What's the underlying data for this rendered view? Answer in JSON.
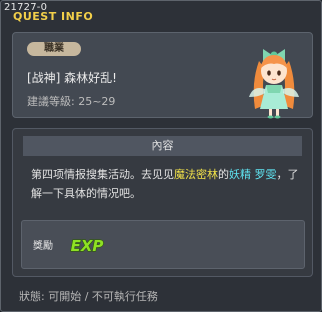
{
  "window": {
    "code": "21727-0",
    "title": "QUEST INFO"
  },
  "info": {
    "job_badge": "職業",
    "quest_name": "[战神] 森林好乱!",
    "level_requirement": "建議等級: 25~29"
  },
  "content": {
    "header": "內容",
    "description": {
      "part1": "第四项情报搜集活动。去见见",
      "place": "魔法密林",
      "part2": "的",
      "npc_type": "妖精",
      "space": " ",
      "npc_name": "罗雯",
      "part3": "，了解一下具体的情况吧。"
    }
  },
  "reward": {
    "label": "獎勵",
    "icon": "exp-icon",
    "icon_text": "EXP"
  },
  "status": "狀態: 可開始 / 不可執行任務",
  "colors": {
    "title": "#f3d04a",
    "place": "#f2e34a",
    "npc": "#5fe3f0",
    "exp": "#8ee024"
  }
}
